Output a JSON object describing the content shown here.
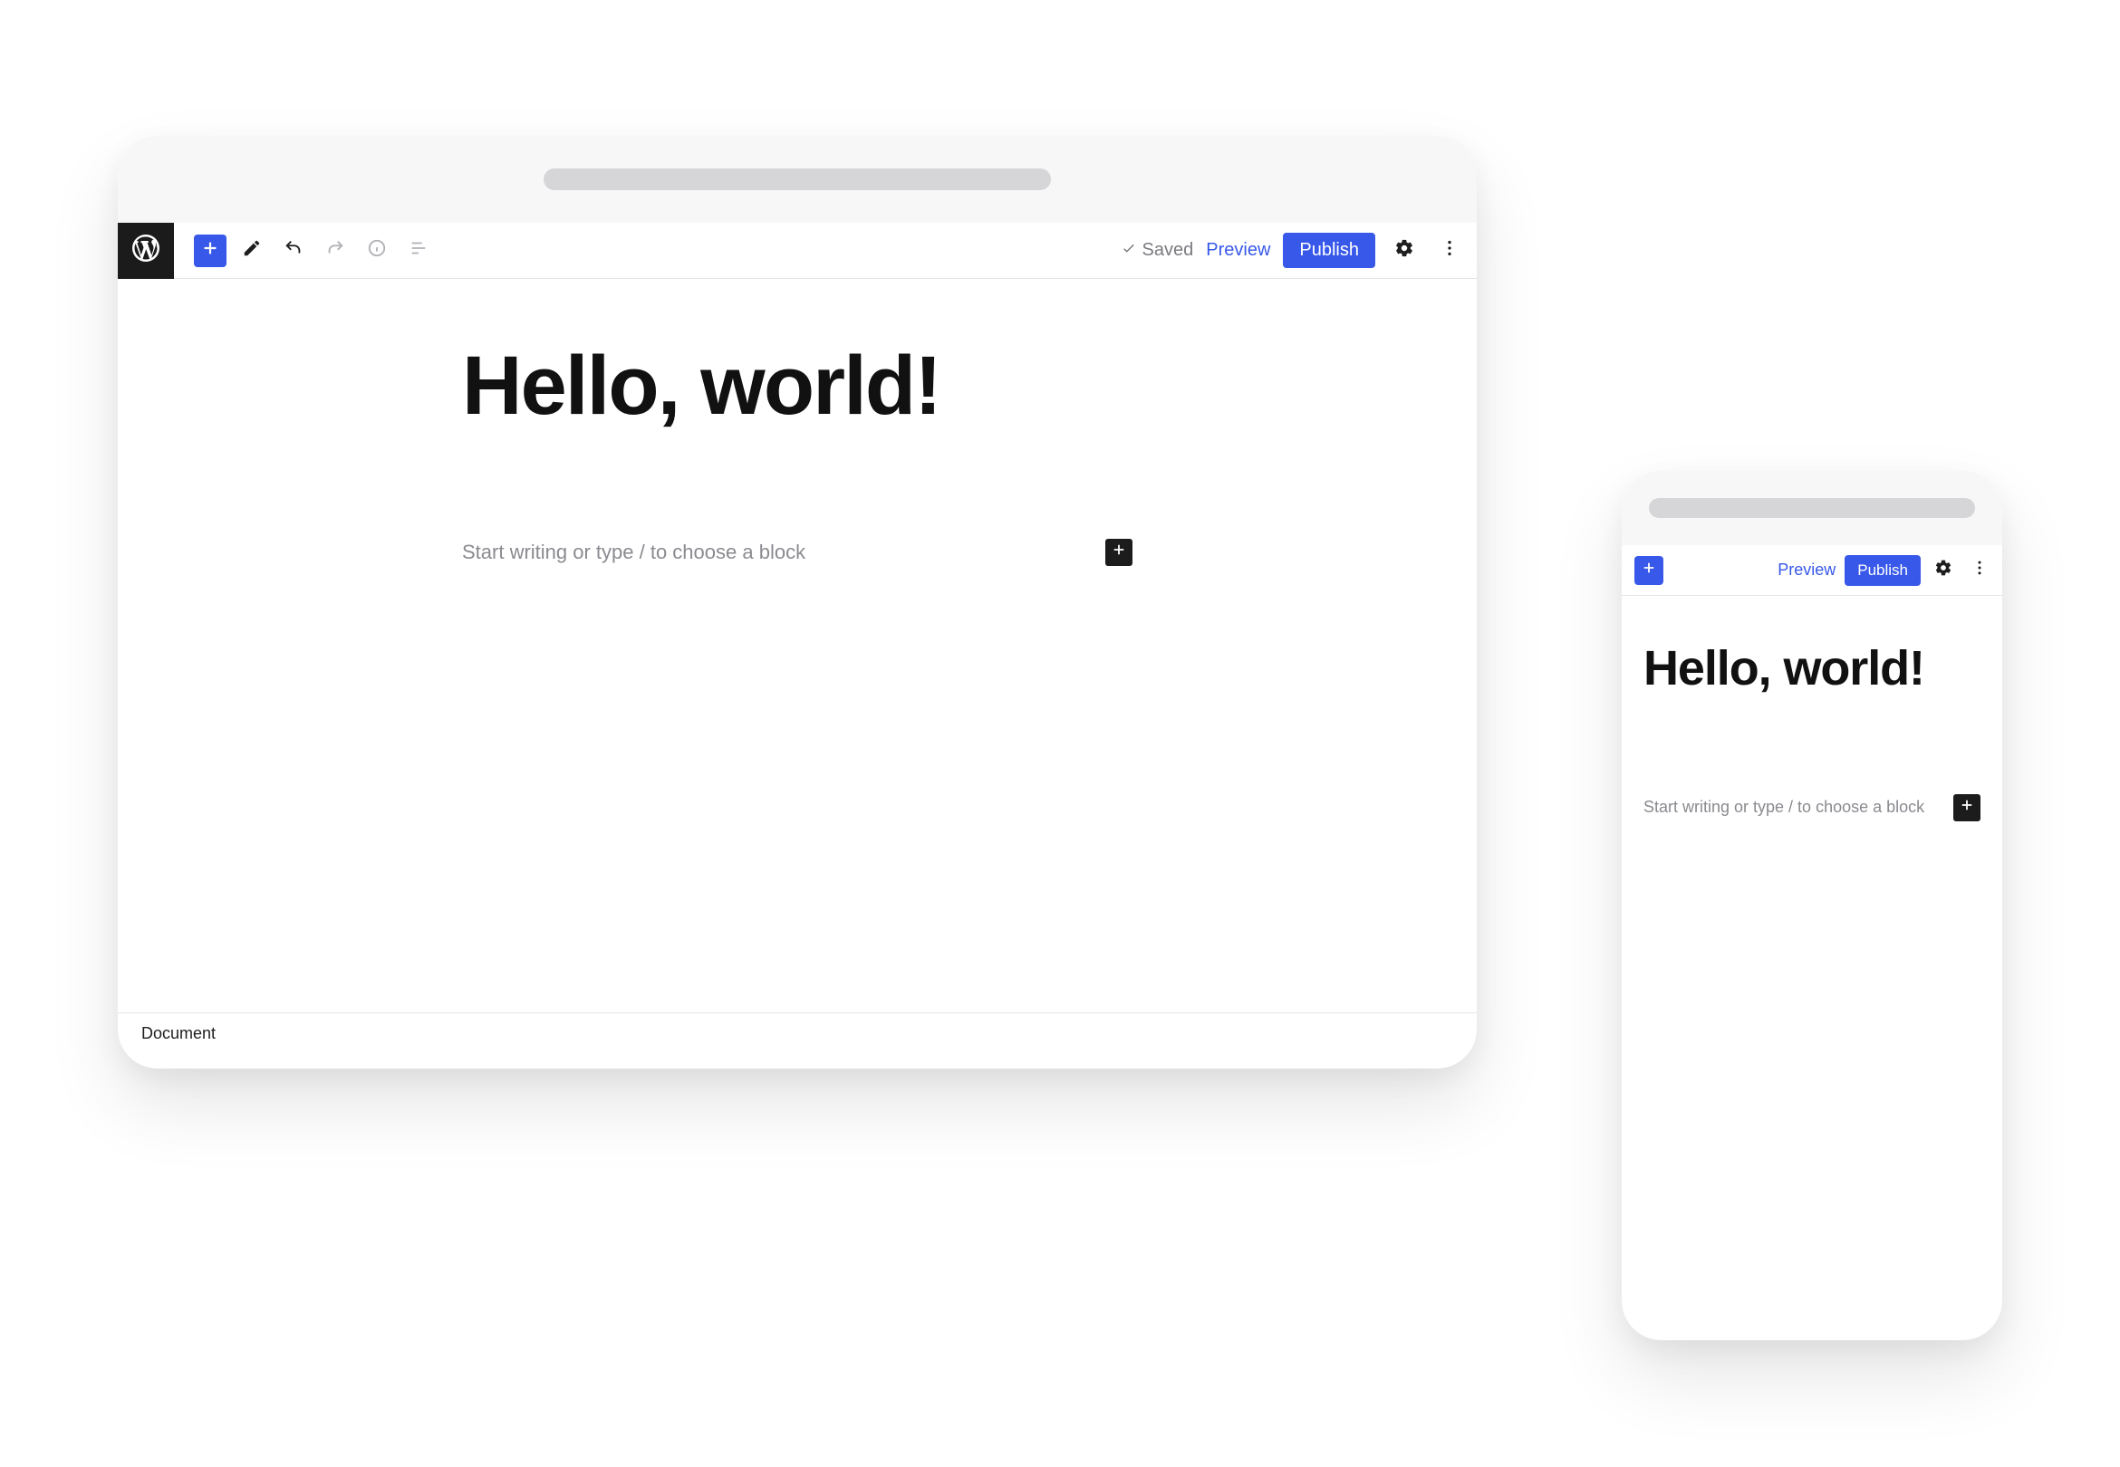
{
  "colors": {
    "accent": "#3858e9"
  },
  "desktop": {
    "toolbar": {
      "saved_label": "Saved",
      "preview_label": "Preview",
      "publish_label": "Publish"
    },
    "post_title": "Hello, world!",
    "block_placeholder": "Start writing or type / to choose a block",
    "footer_breadcrumb": "Document"
  },
  "mobile": {
    "toolbar": {
      "preview_label": "Preview",
      "publish_label": "Publish"
    },
    "post_title": "Hello, world!",
    "block_placeholder": "Start writing or type / to choose a block"
  }
}
